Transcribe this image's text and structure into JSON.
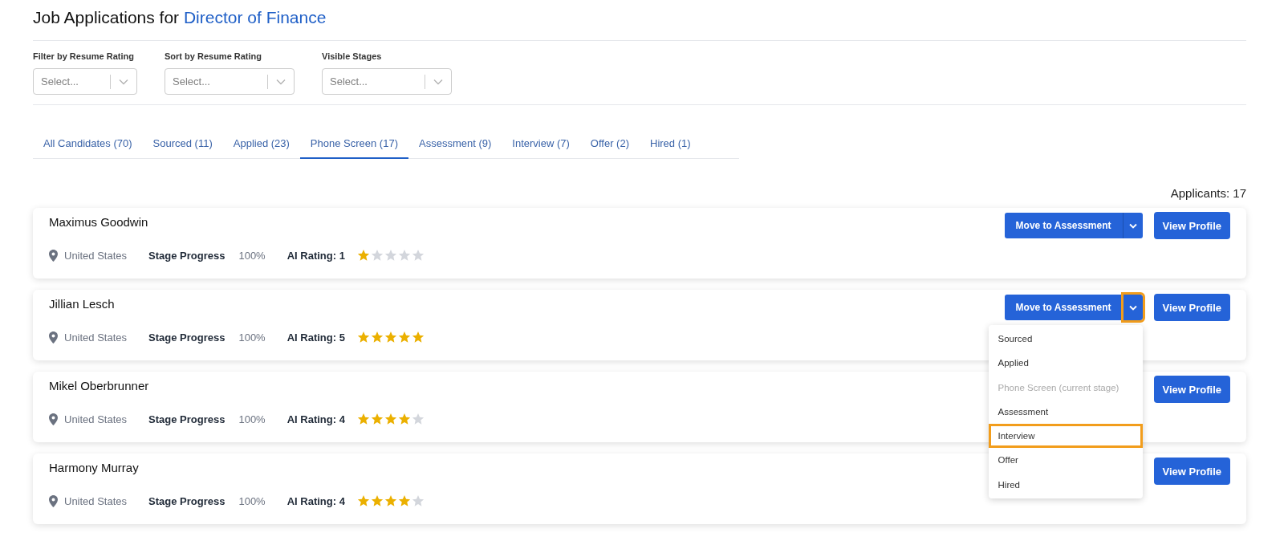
{
  "header": {
    "title_prefix": "Job Applications for",
    "job_title": "Director of Finance"
  },
  "filters": [
    {
      "label": "Filter by Resume Rating",
      "placeholder": "Select..."
    },
    {
      "label": "Sort by Resume Rating",
      "placeholder": "Select..."
    },
    {
      "label": "Visible Stages",
      "placeholder": "Select..."
    }
  ],
  "tabs": [
    {
      "label": "All Candidates (70)",
      "selected": false
    },
    {
      "label": "Sourced (11)",
      "selected": false
    },
    {
      "label": "Applied (23)",
      "selected": false
    },
    {
      "label": "Phone Screen (17)",
      "selected": true
    },
    {
      "label": "Assessment (9)",
      "selected": false
    },
    {
      "label": "Interview (7)",
      "selected": false
    },
    {
      "label": "Offer (2)",
      "selected": false
    },
    {
      "label": "Hired (1)",
      "selected": false
    }
  ],
  "applicant_count": "Applicants: 17",
  "rows": [
    {
      "name": "Maximus Goodwin",
      "location": "United States",
      "progress_label": "Stage Progress",
      "progress": "100%",
      "rating_label": "AI Rating: 1",
      "stars": 1,
      "move_button": "Move to Assessment",
      "toggle_highlighted": false,
      "menu_open": false,
      "view_button": "View Profile"
    },
    {
      "name": "Jillian Lesch",
      "location": "United States",
      "progress_label": "Stage Progress",
      "progress": "100%",
      "rating_label": "AI Rating: 5",
      "stars": 5,
      "move_button": "Move to Assessment",
      "toggle_highlighted": true,
      "menu_open": true,
      "view_button": "View Profile"
    },
    {
      "name": "Mikel Oberbrunner",
      "location": "United States",
      "progress_label": "Stage Progress",
      "progress": "100%",
      "rating_label": "AI Rating: 4",
      "stars": 4,
      "view_button": "View Profile"
    },
    {
      "name": "Harmony Murray",
      "location": "United States",
      "progress_label": "Stage Progress",
      "progress": "100%",
      "rating_label": "AI Rating: 4",
      "stars": 4,
      "view_button": "View Profile"
    }
  ],
  "stage_menu": [
    {
      "label": "Sourced",
      "disabled": false,
      "highlighted": false
    },
    {
      "label": "Applied",
      "disabled": false,
      "highlighted": false
    },
    {
      "label": "Phone Screen (current stage)",
      "disabled": true,
      "highlighted": false
    },
    {
      "label": "Assessment",
      "disabled": false,
      "highlighted": false
    },
    {
      "label": "Interview",
      "disabled": false,
      "highlighted": true
    },
    {
      "label": "Offer",
      "disabled": false,
      "highlighted": false
    },
    {
      "label": "Hired",
      "disabled": false,
      "highlighted": false
    }
  ]
}
